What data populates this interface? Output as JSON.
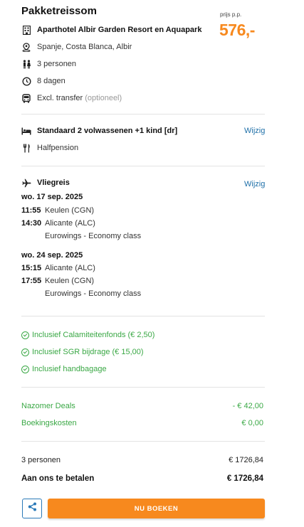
{
  "header": {
    "title": "Pakketreissom",
    "price_label": "prijs p.p.",
    "price": "576,-"
  },
  "package": {
    "hotel": "Aparthotel Albir Garden Resort en Aquapark",
    "location": "Spanje, Costa Blanca, Albir",
    "persons": "3 personen",
    "duration": "8 dagen",
    "transfer": "Excl. transfer",
    "transfer_note": "(optioneel)"
  },
  "room": {
    "type": "Standaard 2 volwassenen +1 kind [dr]",
    "board": "Halfpension",
    "edit_label": "Wijzig"
  },
  "flight": {
    "title": "Vliegreis",
    "edit_label": "Wijzig",
    "outbound": {
      "date": "wo. 17 sep. 2025",
      "dep_time": "11:55",
      "dep_place": "Keulen (CGN)",
      "arr_time": "14:30",
      "arr_place": "Alicante (ALC)",
      "carrier": "Eurowings - Economy class"
    },
    "return": {
      "date": "wo. 24 sep. 2025",
      "dep_time": "15:15",
      "dep_place": "Alicante (ALC)",
      "arr_time": "17:55",
      "arr_place": "Keulen (CGN)",
      "carrier": "Eurowings - Economy class"
    }
  },
  "inclusions": [
    "Inclusief Calamiteitenfonds (€ 2,50)",
    "Inclusief SGR bijdrage (€ 15,00)",
    "Inclusief handbagage"
  ],
  "adjustments": [
    {
      "label": "Nazomer Deals",
      "value": "- € 42,00"
    },
    {
      "label": "Boekingskosten",
      "value": "€ 0,00"
    }
  ],
  "totals": {
    "persons_label": "3 personen",
    "persons_value": "€ 1726,84",
    "pay_label": "Aan ons te betalen",
    "pay_value": "€ 1726,84"
  },
  "actions": {
    "book_label": "NU BOEKEN"
  },
  "colors": {
    "accent": "#f7891e",
    "link": "#1e6fa8",
    "positive": "#3aa845"
  }
}
